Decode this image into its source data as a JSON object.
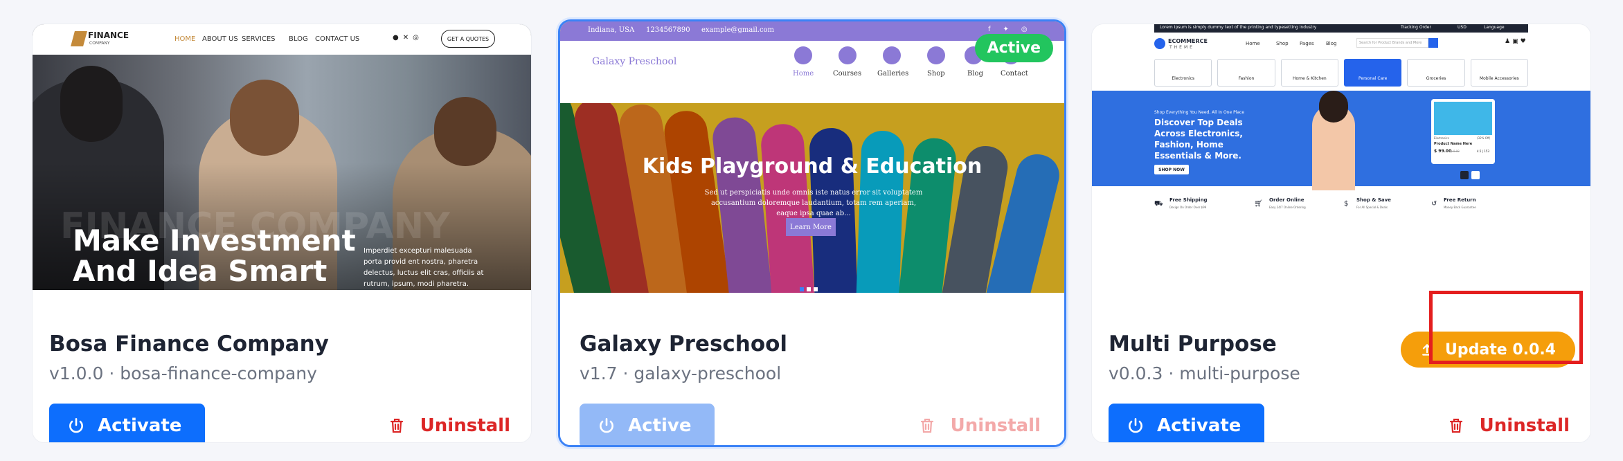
{
  "themes": [
    {
      "name": "Bosa Finance Company",
      "meta": "v1.0.0 · bosa-finance-company",
      "primary_label": "Activate",
      "uninstall_label": "Uninstall",
      "preview": {
        "logo": "FINANCE",
        "logo_sub": "COMPANY",
        "nav": [
          "HOME",
          "ABOUT US",
          "SERVICES",
          "BLOG",
          "CONTACT US"
        ],
        "cta": "GET A QUOTES",
        "headline_1": "Make Investment",
        "headline_2": "And Idea Smart",
        "watermark": "FINANCE COMPANY",
        "body": "Imperdiet excepturi malesuada porta provid ent nostra, pharetra delectus, luctus elit cras, officiis at rutrum, ipsum, modi pharetra."
      }
    },
    {
      "name": "Galaxy Preschool",
      "meta": "v1.7 · galaxy-preschool",
      "primary_label": "Active",
      "uninstall_label": "Uninstall",
      "active_badge": "Active",
      "preview": {
        "topbar": [
          "Indiana, USA",
          "1234567890",
          "example@gmail.com"
        ],
        "brand": "Galaxy Preschool",
        "nav": [
          "Home",
          "Courses",
          "Galleries",
          "Shop",
          "Blog",
          "Contact"
        ],
        "headline": "Kids Playground & Education",
        "body": "Sed ut perspiciatis unde omnis iste natus error sit voluptatem accusantium doloremque laudantium, totam rem aperiam, eaque ipsa quae ab...",
        "cta": "Learn More"
      }
    },
    {
      "name": "Multi Purpose",
      "meta": "v0.0.3 · multi-purpose",
      "primary_label": "Activate",
      "uninstall_label": "Uninstall",
      "update_label": "Update 0.0.4",
      "preview": {
        "topbar": "Lorem Ipsum is simply dummy text of the printing and typesetting industry",
        "topbar_right": [
          "Tracking Order",
          "USD",
          "Language"
        ],
        "logo": "ECOMMERCE",
        "logo_sub": "THEME",
        "nav": [
          "Home",
          "Shop",
          "Pages",
          "Blog"
        ],
        "search_placeholder": "Search for Product Brands and More",
        "categories": [
          {
            "label": "Electronics",
            "icon": "monitor-icon"
          },
          {
            "label": "Fashion",
            "icon": "shirt-icon"
          },
          {
            "label": "Home & Kitchen",
            "icon": "kitchen-icon"
          },
          {
            "label": "Personal Care",
            "icon": "bottle-icon"
          },
          {
            "label": "Groceries",
            "icon": "leaf-icon"
          },
          {
            "label": "Mobile Accessories",
            "icon": "phone-icon"
          }
        ],
        "banner_small": "Shop Everything You Need, All In One Place",
        "banner_headline": "Discover Top Deals Across Electronics, Fashion, Home Essentials & More.",
        "banner_cta": "SHOP NOW",
        "product": {
          "category": "Electronics",
          "discount": "(32% Off)",
          "name": "Product Name Here",
          "price": "$ 99.00",
          "old_price": "$ 0.00",
          "rating": "4.5 | 153"
        },
        "features": [
          {
            "title": "Free Shipping",
            "sub": "Design On Order Over $99"
          },
          {
            "title": "Order Online",
            "sub": "Easy 24/7 Online Ordering"
          },
          {
            "title": "Shop & Save",
            "sub": "For All Special & Deals"
          },
          {
            "title": "Free Return",
            "sub": "Money Back Guarantee"
          }
        ]
      }
    }
  ],
  "colors": {
    "primary": "#0d6efd",
    "danger": "#dc2626",
    "update": "#f59e0b",
    "active_badge": "#22c55e",
    "highlight": "#e41e1e"
  }
}
